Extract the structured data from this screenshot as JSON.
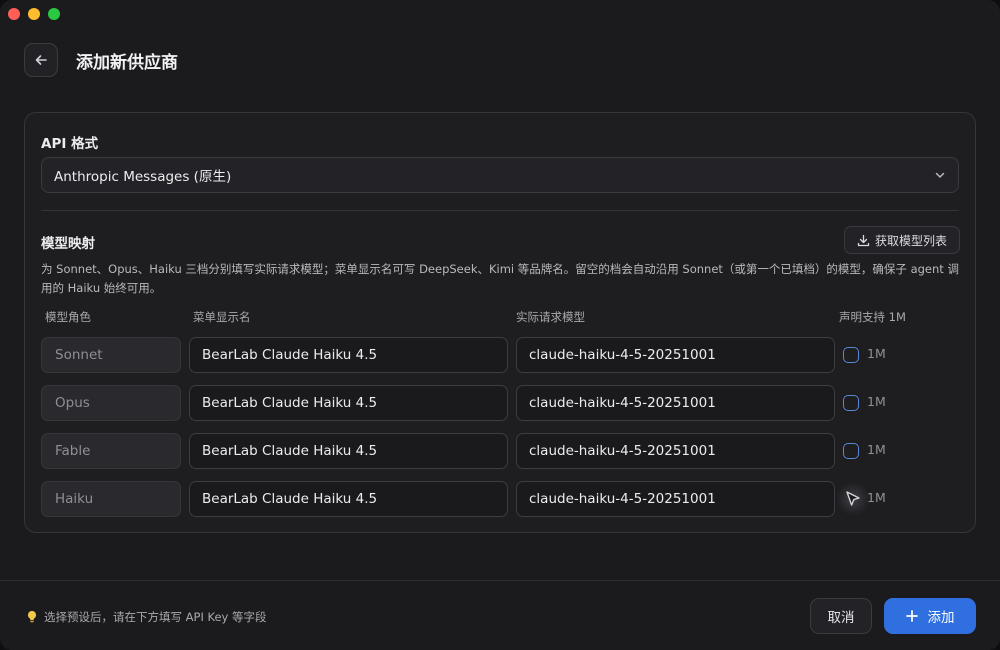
{
  "header": {
    "title": "添加新供应商"
  },
  "api_format": {
    "label": "API 格式",
    "selected": "Anthropic Messages (原生)"
  },
  "model_mapping": {
    "title": "模型映射",
    "fetch_button": "获取模型列表",
    "description": "为 Sonnet、Opus、Haiku 三档分别填写实际请求模型；菜单显示名可写 DeepSeek、Kimi 等品牌名。留空的档会自动沿用 Sonnet（或第一个已填档）的模型，确保子 agent 调用的 Haiku 始终可用。",
    "columns": {
      "role": "模型角色",
      "display_name": "菜单显示名",
      "request_model": "实际请求模型",
      "support_1m": "声明支持 1M"
    },
    "rows": [
      {
        "role": "Sonnet",
        "display_name": "BearLab Claude Haiku 4.5",
        "request_model": "claude-haiku-4-5-20251001",
        "flag_label": "1M"
      },
      {
        "role": "Opus",
        "display_name": "BearLab Claude Haiku 4.5",
        "request_model": "claude-haiku-4-5-20251001",
        "flag_label": "1M"
      },
      {
        "role": "Fable",
        "display_name": "BearLab Claude Haiku 4.5",
        "request_model": "claude-haiku-4-5-20251001",
        "flag_label": "1M"
      },
      {
        "role": "Haiku",
        "display_name": "BearLab Claude Haiku 4.5",
        "request_model": "claude-haiku-4-5-20251001",
        "flag_label": "1M"
      }
    ]
  },
  "footer": {
    "hint": "选择预设后，请在下方填写 API Key 等字段",
    "cancel": "取消",
    "add": "添加"
  },
  "colors": {
    "accent": "#2f6fe0",
    "checkbox": "#5a86d6"
  },
  "icons": [
    "back-arrow-icon",
    "chevron-down-icon",
    "download-icon",
    "lightbulb-icon",
    "plus-icon",
    "cursor-icon"
  ]
}
